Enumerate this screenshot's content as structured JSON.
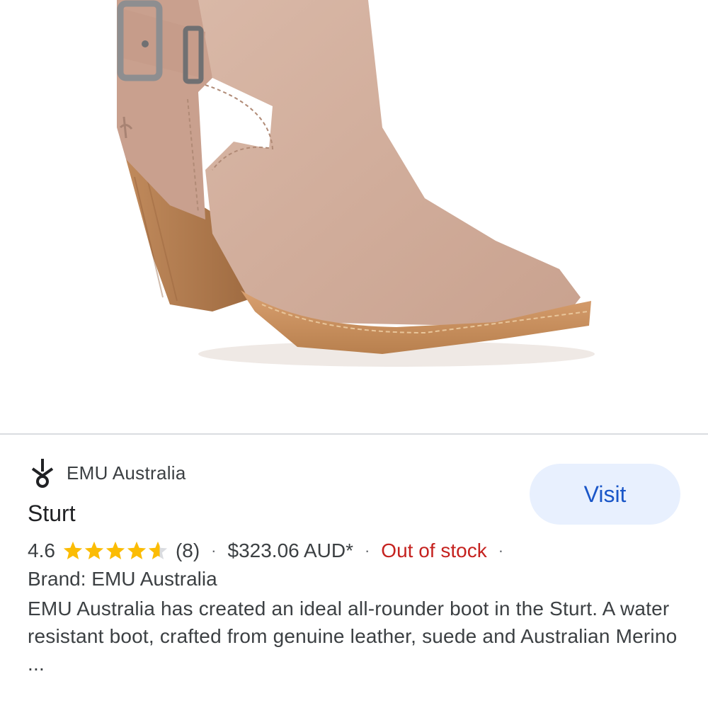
{
  "product_image": {
    "alt": "Sturt"
  },
  "merchant": {
    "logo_icon": "emu-logo-icon",
    "name": "EMU Australia"
  },
  "visit_label": "Visit",
  "title": "Sturt",
  "rating": {
    "value": "4.6",
    "stars_filled": 4.6,
    "stars_total": 5,
    "count": "(8)"
  },
  "separator": "·",
  "price": "$323.06 AUD*",
  "stock_status": "Out of stock",
  "brand": "Brand: EMU Australia",
  "description": "EMU Australia has created an ideal all-rounder boot in the Sturt. A water resistant boot, crafted from genuine leather, suede and Australian Merino ...",
  "colors": {
    "visit_bg": "#e8f0fe",
    "visit_text": "#1a56c8",
    "star": "#fbbc04",
    "out_of_stock": "#c5221f",
    "leather": "#d2ae9c",
    "heel": "#b07a4e"
  }
}
